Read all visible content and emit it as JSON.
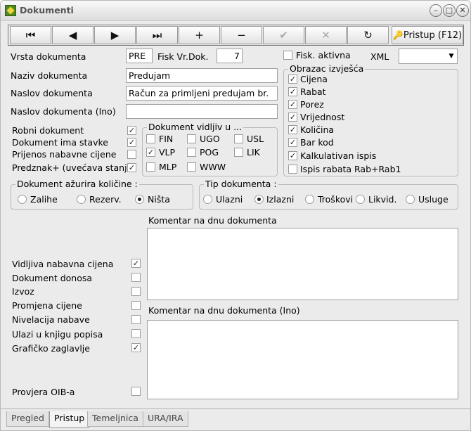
{
  "window": {
    "title": "Dokumenti"
  },
  "toolbar": {
    "first": "⏮",
    "prev": "◀",
    "next": "▶",
    "last": "⏭",
    "add": "+",
    "remove": "−",
    "confirm": "✔",
    "cancel": "✕",
    "refresh": "↻",
    "pristup": "Pristup (F12)"
  },
  "form": {
    "vrsta_label": "Vrsta dokumenta",
    "vrsta_value": "PRE",
    "fisk_vr_label": "Fisk Vr.Dok.",
    "fisk_vr_value": "7",
    "fisk_aktivna": "Fisk. aktivna",
    "xml_label": "XML",
    "xml_value": "",
    "naziv_label": "Naziv dokumenta",
    "naziv_value": "Predujam",
    "naslov_label": "Naslov dokumenta",
    "naslov_value": "Račun za primljeni predujam br.",
    "naslov_ino_label": "Naslov dokumenta (Ino)",
    "naslov_ino_value": ""
  },
  "left_checks": [
    "Robni dokument",
    "Dokument ima stavke",
    "Prijenos nabavne cijene",
    "Predznak+ (uvećava stanje)"
  ],
  "vidljiv": {
    "title": "Dokument vidljiv u ...",
    "items": [
      "FIN",
      "UGO",
      "USL",
      "VLP",
      "POG",
      "LIK",
      "MLP",
      "WWW"
    ]
  },
  "obrazac": {
    "title": "Obrazac izvješća",
    "items": [
      "Cijena",
      "Rabat",
      "Porez",
      "Vrijednost",
      "Količina",
      "Bar kod",
      "Kalkulativan ispis",
      "Ispis rabata Rab+Rab1"
    ]
  },
  "azurira": {
    "title": "Dokument ažurira količine :",
    "options": [
      "Zalihe",
      "Rezerv.",
      "Ništa"
    ]
  },
  "tip": {
    "title": "Tip dokumenta :",
    "options": [
      "Ulazni",
      "Izlazni",
      "Troškovi",
      "Likvid.",
      "Usluge"
    ]
  },
  "lower_checks": [
    "Vidljiva nabavna cijena",
    "Dokument donosa",
    "Izvoz",
    "Promjena cijene",
    "Nivelacija nabave",
    "Ulazi u knjigu popisa",
    "Grafičko zaglavlje"
  ],
  "oib_label": "Provjera OIB-a",
  "komentar_label": "Komentar na dnu dokumenta",
  "komentar_ino_label": "Komentar na dnu dokumenta (Ino)",
  "tabs": [
    "Pregled",
    "Pristup",
    "Temeljnica",
    "URA/IRA"
  ]
}
